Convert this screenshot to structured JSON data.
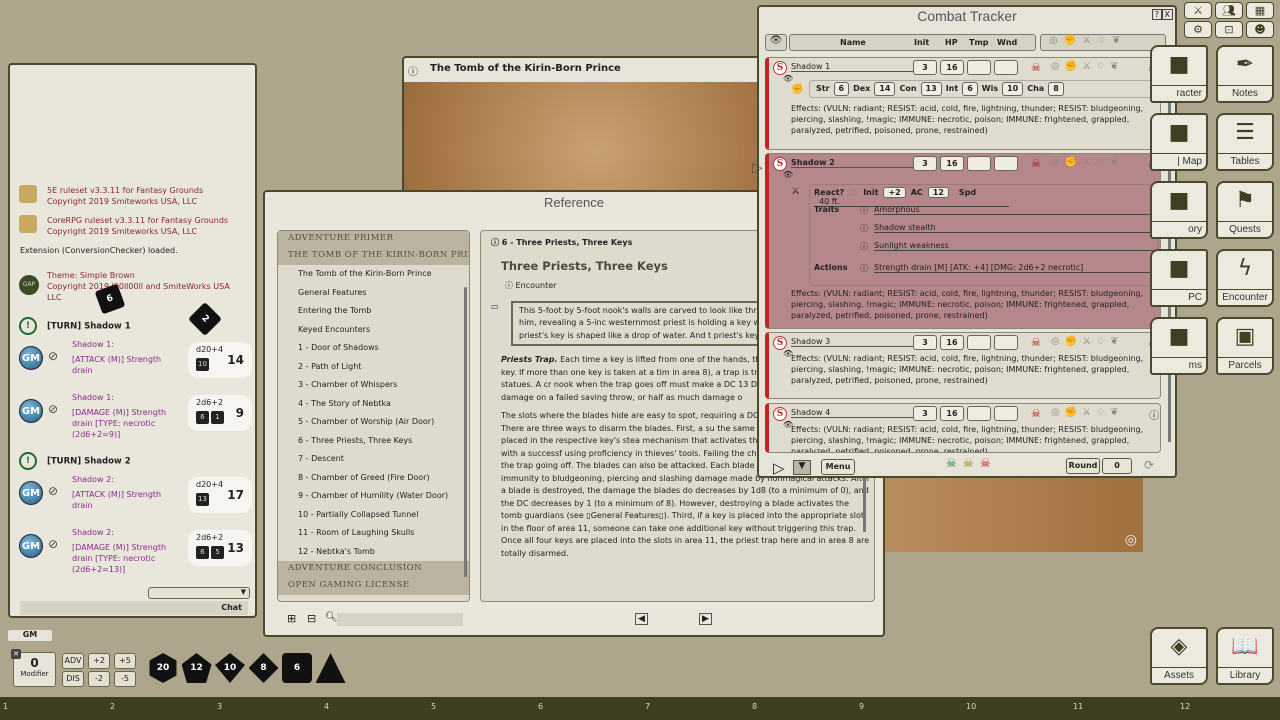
{
  "chat": {
    "messages": [
      {
        "text": "5E ruleset v3.3.11 for Fantasy Grounds",
        "sub": "Copyright 2019 Smiteworks USA, LLC"
      },
      {
        "text": "CoreRPG ruleset v3.3.11 for Fantasy Grounds",
        "sub": "Copyright 2019 Smiteworks USA, LLC"
      }
    ],
    "extension": "Extension (ConversionChecker) loaded.",
    "theme": {
      "badge": "GAP",
      "text": "Theme: Simple Brown",
      "sub": "Copyright 2019 l00ll00ll and SmiteWorks USA LLC"
    },
    "turn1": "[TURN] Shadow 1",
    "turn2": "[TURN] Shadow 2",
    "rolls": [
      {
        "speaker": "Shadow 1:",
        "text": "[ATTACK (M)] Strength drain",
        "expr": "d20+4",
        "dice": [
          "10"
        ],
        "total": "14"
      },
      {
        "speaker": "Shadow 1:",
        "text": "[DAMAGE (M)] Strength drain [TYPE: necrotic (2d6+2=9)]",
        "expr": "2d6+2",
        "dice": [
          "6",
          "1"
        ],
        "total": "9"
      },
      {
        "speaker": "Shadow 2:",
        "text": "[ATTACK (M)] Strength drain",
        "expr": "d20+4",
        "dice": [
          "13"
        ],
        "total": "17"
      },
      {
        "speaker": "Shadow 2:",
        "text": "[DAMAGE (M)] Strength drain [TYPE: necrotic (2d6+2=13)]",
        "expr": "2d6+2",
        "dice": [
          "6",
          "5"
        ],
        "total": "13"
      }
    ],
    "gm_label": "GM",
    "floating_dice": [
      "6",
      "2"
    ],
    "chat_label": "Chat",
    "identity": "GM"
  },
  "modifier": {
    "value": "0",
    "label": "Modifier"
  },
  "mod_buttons": [
    "ADV",
    "+2",
    "+5",
    "DIS",
    "-2",
    "-5"
  ],
  "dice_tray": [
    "20",
    "12",
    "10",
    "8",
    "6",
    ""
  ],
  "map": {
    "title": "The Tomb of the Kirin-Born Prince"
  },
  "reference": {
    "title": "Reference",
    "groups_top": [
      "ADVENTURE PRIMER",
      "THE TOMB OF THE KIRIN-BORN PRINCE"
    ],
    "items": [
      "The Tomb of the Kirin-Born Prince",
      "General Features",
      "Entering the Tomb",
      "Keyed Encounters",
      "1 - Door of Shadows",
      "2 - Path of Light",
      "3 - Chamber of Whispers",
      "4 - The Story of Nebtka",
      "5 - Chamber of Worship (Air Door)",
      "6 - Three Priests, Three Keys",
      "7 - Descent",
      "8 - Chamber of Greed (Fire Door)",
      "9 - Chamber of Humility (Water Door)",
      "10 - Partially Collapsed Tunnel",
      "11 - Room of Laughing Skulls",
      "12 - Nebtka's Tomb"
    ],
    "groups_bottom": [
      "ADVENTURE CONCLUSION",
      "OPEN GAMING LICENSE"
    ],
    "page_header": "6 - Three Priests, Three Keys",
    "heading": "Three Priests, Three Keys",
    "link": "Encounter",
    "boxed": "This 5-foot by 5-foot nook's walls are carved to look like three E warrior is holding his hand out in front of him, revealing a 5-inc westernmost priest is holding a key with a bow in the shape of southernmost priest's key is shaped like a drop of water. And t priest's key resembles a gust of wind.",
    "p1_bold": "Priests Trap.",
    "p1": " Each time a key is lifted from one of the hands, the resp denoting the absence of its key. If more than one key is taken at a tim in area 8), a trap is triggered. Blades swing out from the statues. A cr nook when the trap goes off must make a DC 13 Dexterity saving thro slashing damage on a failed saving throw, or half as much damage o",
    "p2": "The slots where the blades hide are easy to spot, requiring a DC 10 W check to notice. There are three ways to disarm the blades. First, a su the same as the stolen key can be placed in the respective key's stea mechanism that activates the blade can be disarmed with a successf using proficiency in thieves' tools. Failing the check by 5 or more results in the trap going off. The blades can also be attacked. Each blade has an AC of 19, 10 hp, and immunity to bludgeoning, piercing and slashing damage made by nonmagical attacks. After a blade is destroyed, the damage the blades do decreases by 1d8 (to a minimum of 0), and the DC decreases by 1 (to a minimum of 8). However, destroying a blade activates the tomb guardians (see ▯General Features▯). Third, if a key is placed into the appropriate slot in the floor of area 11, someone can take one additional key without triggering this trap. Once all four keys are placed into the slots in area 11, the priest trap here and in area 8 are totally disarmed."
  },
  "combat": {
    "title": "Combat Tracker",
    "columns": [
      "Name",
      "Init",
      "HP",
      "Tmp",
      "Wnd"
    ],
    "effects": "Effects: (VULN: radiant; RESIST: acid, cold, fire, lightning, thunder; RESIST: bludgeoning, piercing, slashing, !magic; IMMUNE: necrotic, poison; IMMUNE: frightened, grappled, paralyzed, petrified, poisoned, prone, restrained)",
    "entries": [
      {
        "name": "Shadow 1",
        "init": "3",
        "hp": "16",
        "tmp": "",
        "wnd": ""
      },
      {
        "name": "Shadow 2",
        "init": "3",
        "hp": "16",
        "tmp": "",
        "wnd": ""
      },
      {
        "name": "Shadow 3",
        "init": "3",
        "hp": "16",
        "tmp": "",
        "wnd": ""
      },
      {
        "name": "Shadow 4",
        "init": "3",
        "hp": "16",
        "tmp": "",
        "wnd": ""
      }
    ],
    "abilities": [
      [
        "Str",
        "6"
      ],
      [
        "Dex",
        "14"
      ],
      [
        "Con",
        "13"
      ],
      [
        "Int",
        "6"
      ],
      [
        "Wis",
        "10"
      ],
      [
        "Cha",
        "8"
      ]
    ],
    "detail": {
      "react": "React?",
      "init_label": "Init",
      "init": "+2",
      "ac_label": "AC",
      "ac": "12",
      "spd_label": "Spd",
      "spd": "40 ft.",
      "traits_label": "Traits",
      "traits": [
        "Amorphous",
        "Shadow stealth",
        "Sunlight weakness"
      ],
      "actions_label": "Actions",
      "actions": [
        "Strength drain [M] [ATK: +4] [DMG: 2d6+2 necrotic]"
      ]
    },
    "menu": "Menu",
    "round_label": "Round",
    "round": "0",
    "active_color": "#b6878a"
  },
  "sidebar": {
    "partial": [
      "racter",
      "| Map",
      "ory",
      "PC",
      "ms"
    ],
    "buttons": [
      {
        "label": "Notes",
        "icon": "✒"
      },
      {
        "label": "Tables",
        "icon": "☰"
      },
      {
        "label": "Quests",
        "icon": "⚑"
      },
      {
        "label": "Encounter",
        "icon": "ϟ"
      },
      {
        "label": "Parcels",
        "icon": "▣"
      }
    ],
    "bottom": [
      {
        "label": "Assets",
        "icon": "◈"
      },
      {
        "label": "Library",
        "icon": "📖"
      }
    ]
  },
  "hotkeys": [
    "1",
    "2",
    "3",
    "4",
    "5",
    "6",
    "7",
    "8",
    "9",
    "10",
    "11",
    "12"
  ]
}
